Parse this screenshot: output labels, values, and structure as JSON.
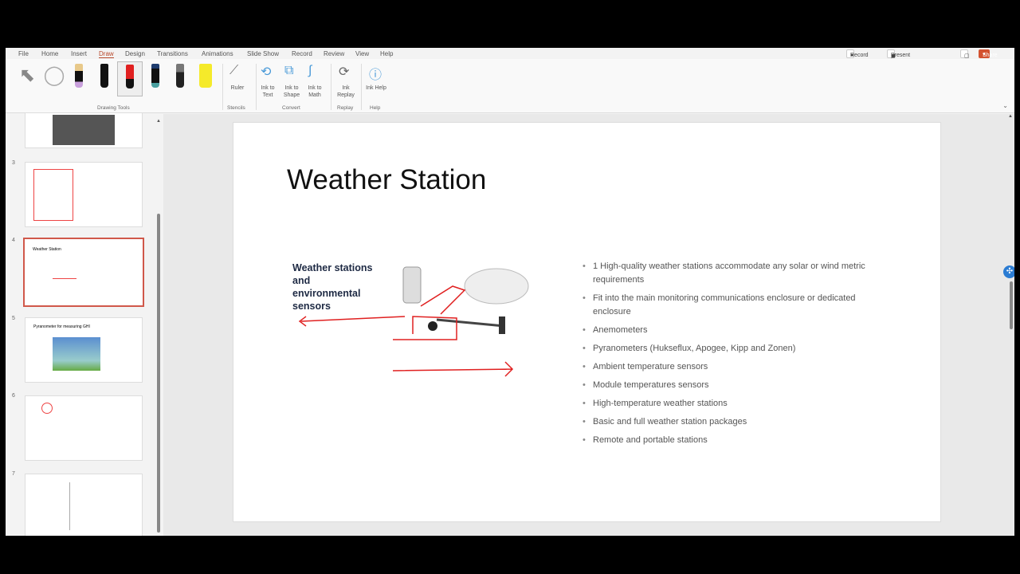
{
  "ribbon_tabs": [
    "File",
    "Home",
    "Insert",
    "Draw",
    "Design",
    "Transitions",
    "Animations",
    "Slide Show",
    "Record",
    "Review",
    "View",
    "Help"
  ],
  "active_tab": "Draw",
  "top_right": {
    "record": "Record",
    "present": "Present in Teams",
    "share": "Share"
  },
  "accent": "#d35230",
  "groups": {
    "drawing_tools": "Drawing Tools",
    "stencils": "Stencils",
    "convert": "Convert",
    "replay": "Replay",
    "help": "Help"
  },
  "buttons": {
    "ruler": "Ruler",
    "ink_to_text": "Ink to Text",
    "ink_to_shape": "Ink to Shape",
    "ink_to_math": "Ink to Math",
    "ink_replay": "Ink Replay",
    "ink_help": "Ink Help"
  },
  "pens": [
    {
      "color": "#e8c98a",
      "tip": "#c9a0dc"
    },
    {
      "color": "#111111",
      "tip": "#111111"
    },
    {
      "color": "#e02020",
      "tip": "#e02020"
    },
    {
      "color": "#1e3c6e",
      "tip": "#4aa0a0"
    },
    {
      "color": "#666666",
      "tip": "#333333"
    },
    {
      "color": "#f5ea2a",
      "tip": "#f5ea2a"
    }
  ],
  "thumbnails": [
    {
      "num": ""
    },
    {
      "num": "3"
    },
    {
      "num": "4",
      "title": "Weather Station"
    },
    {
      "num": "5",
      "title": "Pyranometer for measuring GHI"
    },
    {
      "num": "6"
    },
    {
      "num": "7"
    }
  ],
  "slide": {
    "title": "Weather Station",
    "subhead": "Weather stations and environmental sensors",
    "bullets": [
      "1 High-quality weather stations accommodate any solar or wind metric requirements",
      "Fit into the main monitoring communications enclosure or dedicated enclosure",
      "Anemometers",
      "Pyranometers (Hukseflux, Apogee, Kipp and Zonen)",
      "Ambient temperature sensors",
      "Module temperatures sensors",
      "High-temperature weather stations",
      "Basic and full weather station packages",
      "Remote and portable stations"
    ]
  }
}
